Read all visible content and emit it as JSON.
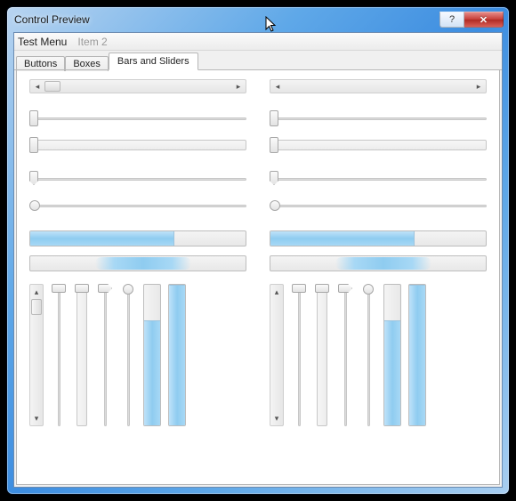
{
  "window": {
    "title": "Control Preview",
    "help_symbol": "?",
    "close_symbol": "✕"
  },
  "menubar": {
    "items": [
      "Test Menu",
      "Item 2"
    ],
    "disabled_index": 1
  },
  "tabs": {
    "items": [
      "Buttons",
      "Boxes",
      "Bars and Sliders"
    ],
    "active_index": 2
  },
  "sliders": {
    "h_progress_pct": 67,
    "v_progress_pct_a": 75,
    "v_progress_pct_b": 100
  },
  "glyphs": {
    "left": "◂",
    "right": "▸",
    "up": "▴",
    "down": "▾"
  }
}
